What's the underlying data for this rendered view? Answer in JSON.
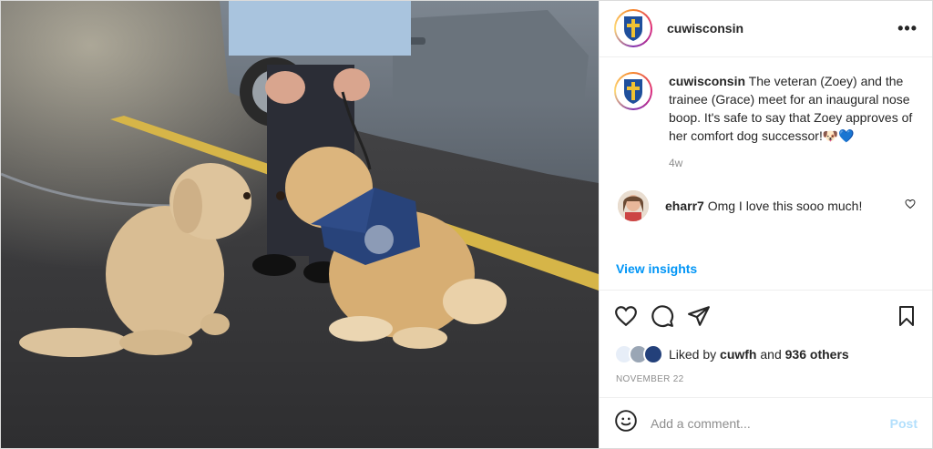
{
  "post": {
    "username": "cuwisconsin",
    "more_label": "•••",
    "image_alt": "Two golden doodle dogs meeting nose to nose in a parking lot"
  },
  "caption": {
    "username": "cuwisconsin",
    "text": "The veteran (Zoey) and the trainee (Grace) meet for an inaugural nose boop. It's safe to say that Zoey approves of her comfort dog successor!🐶💙",
    "age": "4w"
  },
  "comments": [
    {
      "username": "eharr7",
      "text": "Omg I love this sooo much!"
    }
  ],
  "insights_label": "View insights",
  "likes": {
    "prefix": "Liked by",
    "user": "cuwfh",
    "joiner": "and",
    "others": "936 others"
  },
  "date": "NOVEMBER 22",
  "add_comment": {
    "placeholder": "Add a comment...",
    "post_label": "Post"
  },
  "colors": {
    "link": "#0095f6",
    "post_disabled": "#b2dffc",
    "muted": "#8e8e8e"
  }
}
